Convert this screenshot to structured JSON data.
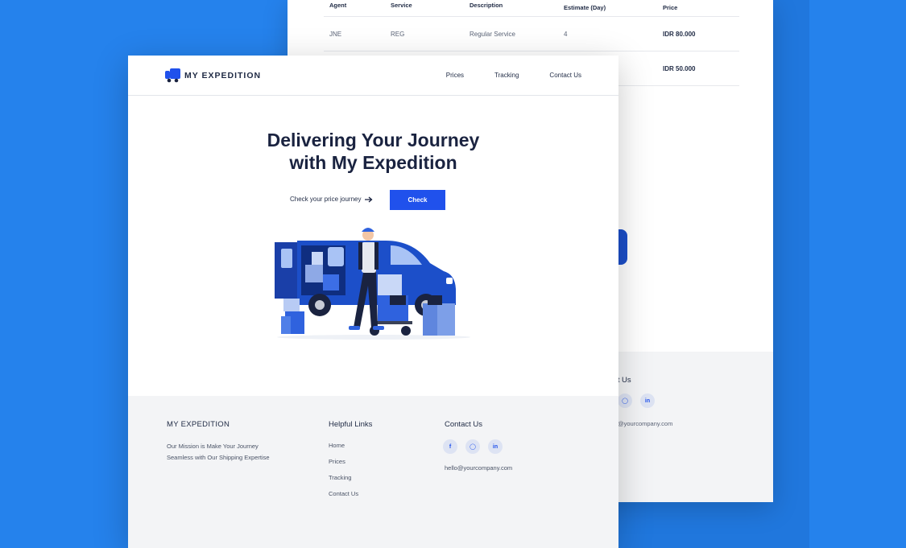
{
  "back_page": {
    "table": {
      "headers": [
        "Agent",
        "Service",
        "Description",
        "Estimate (Day)",
        "Price"
      ],
      "rows": [
        [
          "JNE",
          "REG",
          "Regular Service",
          "4",
          "IDR 80.000"
        ],
        [
          "",
          "",
          "",
          "",
          "IDR 50.000"
        ]
      ]
    },
    "footer": {
      "contact_title": "ct Us",
      "email": "@yourcompany.com"
    }
  },
  "navbar": {
    "logo_text": "MY EXPEDITION",
    "links": [
      "Prices",
      "Tracking",
      "Contact Us"
    ]
  },
  "hero": {
    "title_line1": "Delivering Your Journey",
    "title_line2": "with My Expedition",
    "cta_text": "Check your price journey",
    "button_label": "Check"
  },
  "footer": {
    "brand": "MY EXPEDITION",
    "mission_line1": "Our Mission is Make Your Journey",
    "mission_line2": "Seamless with Our Shipping Expertise",
    "helpful_title": "Helpful Links",
    "helpful_links": [
      "Home",
      "Prices",
      "Tracking",
      "Contact Us"
    ],
    "contact_title": "Contact Us",
    "social": [
      "facebook-icon",
      "instagram-icon",
      "linkedin-icon"
    ],
    "email": "hello@yourcompany.com"
  },
  "colors": {
    "background": "#2582ec",
    "accent": "#2051ec",
    "footer_bg": "#f3f4f6",
    "title": "#1a2340"
  }
}
